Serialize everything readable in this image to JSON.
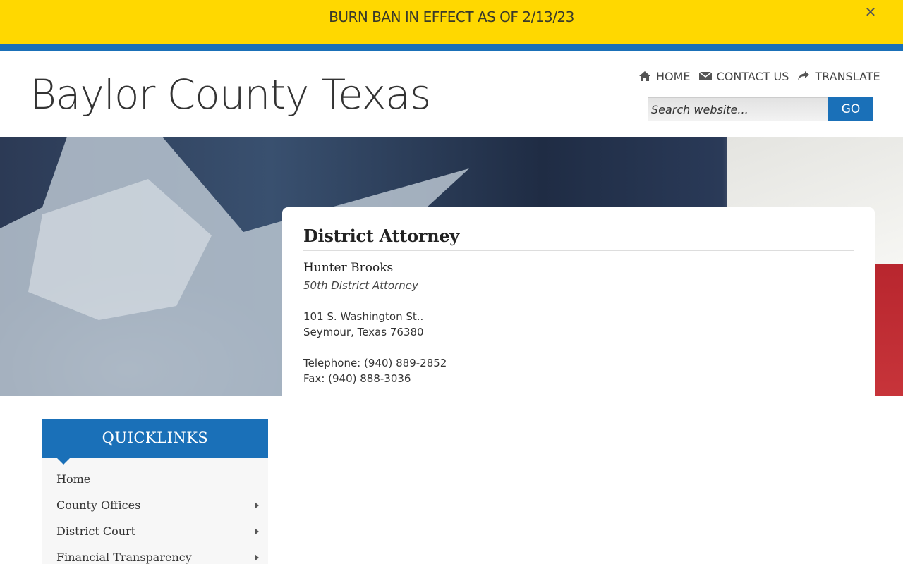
{
  "alert": {
    "text": "BURN BAN IN EFFECT AS OF 2/13/23",
    "close_icon": "close-icon"
  },
  "header": {
    "site_title": "Baylor County Texas",
    "nav": [
      {
        "label": "HOME",
        "icon": "home-icon"
      },
      {
        "label": "CONTACT US",
        "icon": "envelope-icon"
      },
      {
        "label": "TRANSLATE",
        "icon": "share-arrow-icon"
      }
    ],
    "search": {
      "placeholder": "Search website...",
      "value": "",
      "button_label": "GO"
    }
  },
  "main": {
    "heading": "District Attorney",
    "name": "Hunter Brooks",
    "role": "50th District Attorney",
    "address_line1": "101 S. Washington St..",
    "address_line2": "Seymour, Texas 76380",
    "telephone": "Telephone: (940) 889-2852",
    "fax": "Fax: (940) 888-3036"
  },
  "quicklinks": {
    "title": "QUICKLINKS",
    "items": [
      {
        "label": "Home",
        "has_submenu": false
      },
      {
        "label": "County Offices",
        "has_submenu": true
      },
      {
        "label": "District Court",
        "has_submenu": true
      },
      {
        "label": "Financial Transparency",
        "has_submenu": true
      }
    ]
  },
  "colors": {
    "alert_bg": "#ffd800",
    "brand_blue": "#1a70b8"
  }
}
